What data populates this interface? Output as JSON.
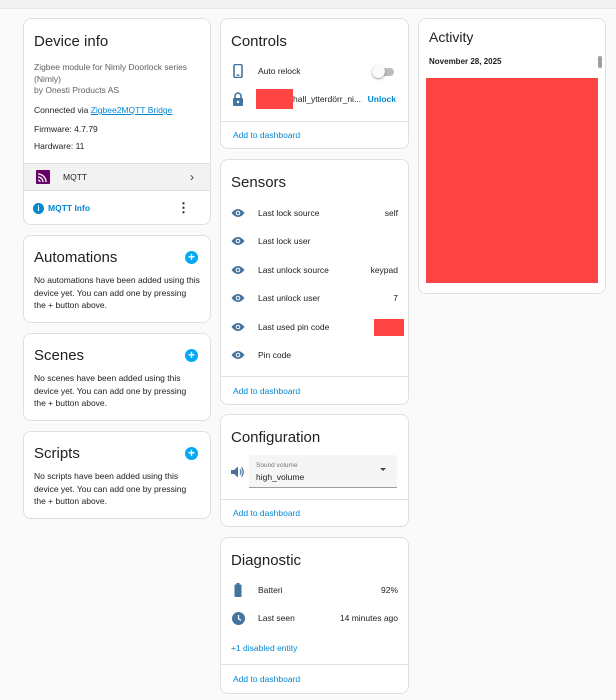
{
  "device_info": {
    "title": "Device info",
    "model": "Zigbee module for Nimly Doorlock series (Nimly)",
    "by": "by Onesti Products AS",
    "connected_prefix": "Connected via ",
    "connected_link": "Zigbee2MQTT Bridge",
    "firmware": "Firmware: 4.7.79",
    "hardware": "Hardware: 11",
    "integration_label": "MQTT",
    "mqtt_info_label": "MQTT Info"
  },
  "automations": {
    "title": "Automations",
    "text": "No automations have been added using this device yet. You can add one by pressing the + button above."
  },
  "scenes": {
    "title": "Scenes",
    "text": "No scenes have been added using this device yet. You can add one by pressing the + button above."
  },
  "scripts": {
    "title": "Scripts",
    "text": "No scripts have been added using this device yet. You can add one by pressing the + button above."
  },
  "controls": {
    "title": "Controls",
    "auto_relock_label": "Auto relock",
    "auto_relock_on": false,
    "lock_label": "hall_ytterdörr_ni...",
    "unlock_label": "Unlock",
    "add_to_dashboard": "Add to dashboard"
  },
  "sensors": {
    "title": "Sensors",
    "items": [
      {
        "label": "Last lock source",
        "value": "self"
      },
      {
        "label": "Last lock user",
        "value": ""
      },
      {
        "label": "Last unlock source",
        "value": "keypad"
      },
      {
        "label": "Last unlock user",
        "value": "7"
      },
      {
        "label": "Last used pin code",
        "value": ""
      },
      {
        "label": "Pin code",
        "value": ""
      }
    ],
    "add_to_dashboard": "Add to dashboard"
  },
  "configuration": {
    "title": "Configuration",
    "select_label": "Sound volume",
    "select_value": "high_volume",
    "add_to_dashboard": "Add to dashboard"
  },
  "diagnostic": {
    "title": "Diagnostic",
    "battery_label": "Batteri",
    "battery_value": "92%",
    "last_seen_label": "Last seen",
    "last_seen_value": "14 minutes ago",
    "disabled_entity": "+1 disabled entity",
    "add_to_dashboard": "Add to dashboard"
  },
  "activity": {
    "title": "Activity",
    "date": "November 28, 2025"
  },
  "colors": {
    "accent": "#0288d1",
    "icon_blue": "#44739e",
    "redaction": "#ff4444",
    "mqtt_purple": "#660066"
  }
}
